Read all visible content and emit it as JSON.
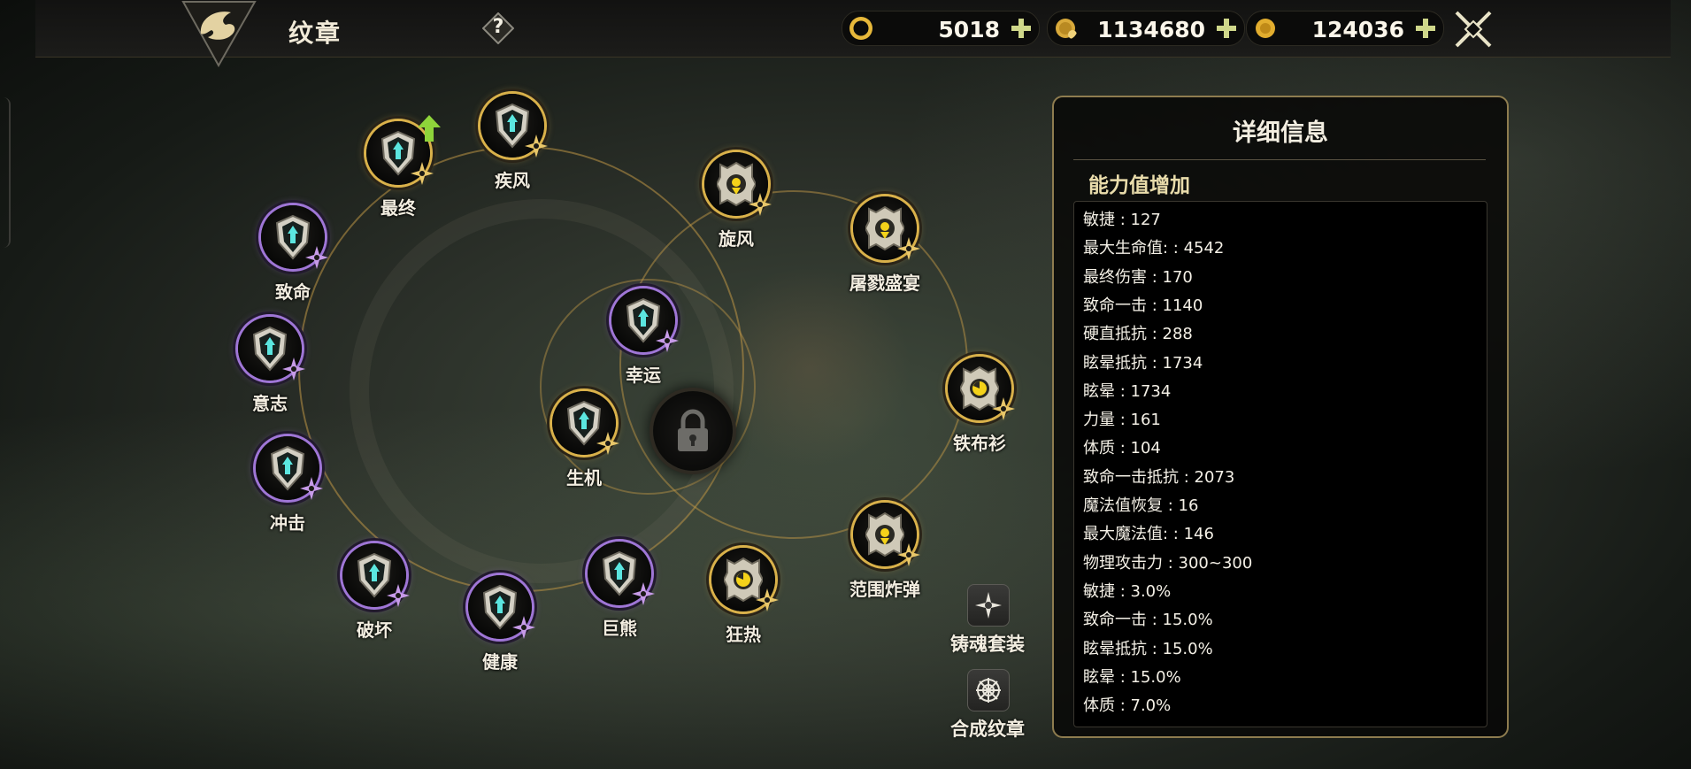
{
  "header": {
    "title": "纹章",
    "help_label": "?"
  },
  "currencies": [
    {
      "icon": "gear-coin-icon",
      "value": "5018",
      "color": "#e7b83a"
    },
    {
      "icon": "gold-coin-bag-icon",
      "value": "1134680",
      "color": "#d8a93a"
    },
    {
      "icon": "gold-coin-icon",
      "value": "124036",
      "color": "#e2ad2e"
    }
  ],
  "plus_label": "+",
  "emblems": [
    {
      "label": "最终",
      "icon": "shield-sword-icon",
      "glyph_color": "#5be6e0",
      "rank": "gold"
    },
    {
      "label": "疾风",
      "icon": "shield-wind-icon",
      "glyph_color": "#5be6e0",
      "rank": "gold"
    },
    {
      "label": "致命",
      "icon": "shield-fang-icon",
      "glyph_color": "#5be6e0",
      "rank": "purple"
    },
    {
      "label": "意志",
      "icon": "shield-cross-icon",
      "glyph_color": "#5be6e0",
      "rank": "purple"
    },
    {
      "label": "冲击",
      "icon": "shield-impact-icon",
      "glyph_color": "#5be6e0",
      "rank": "purple"
    },
    {
      "label": "破坏",
      "icon": "shield-break-icon",
      "glyph_color": "#5be6e0",
      "rank": "purple"
    },
    {
      "label": "健康",
      "icon": "shield-heart-icon",
      "glyph_color": "#5be6e0",
      "rank": "purple"
    },
    {
      "label": "巨熊",
      "icon": "shield-bear-icon",
      "glyph_color": "#5be6e0",
      "rank": "purple"
    },
    {
      "label": "幸运",
      "icon": "shield-clover-icon",
      "glyph_color": "#5be6e0",
      "rank": "purple"
    },
    {
      "label": "生机",
      "icon": "shield-life-icon",
      "glyph_color": "#5be6e0",
      "rank": "gold"
    },
    {
      "label": "旋风",
      "icon": "gear-emblem-icon",
      "glyph_color": "#f4d21a",
      "rank": "gold"
    },
    {
      "label": "屠戮盛宴",
      "icon": "gear-emblem-icon",
      "glyph_color": "#f4d21a",
      "rank": "gold"
    },
    {
      "label": "铁布衫",
      "icon": "gear-clock-icon",
      "glyph_color": "#f4d21a",
      "rank": "gold"
    },
    {
      "label": "范围炸弹",
      "icon": "gear-emblem-icon",
      "glyph_color": "#f4d21a",
      "rank": "gold"
    },
    {
      "label": "狂热",
      "icon": "gear-clock-icon",
      "glyph_color": "#f4d21a",
      "rank": "gold"
    }
  ],
  "actions": {
    "set_label": "铸魂套装",
    "combine_label": "合成纹章"
  },
  "details": {
    "title": "详细信息",
    "subtitle": "能力值增加",
    "stats": [
      "敏捷 : 127",
      "最大生命值:  : 4542",
      "最终伤害 : 170",
      "致命一击 : 1140",
      "硬直抵抗 : 288",
      "眩晕抵抗 : 1734",
      "眩晕 : 1734",
      "力量 : 161",
      "体质 : 104",
      "致命一击抵抗 : 2073",
      "魔法值恢复 : 16",
      "最大魔法值:  : 146",
      "物理攻击力 : 300~300",
      "敏捷 : 3.0%",
      "致命一击 : 15.0%",
      "眩晕抵抗 : 15.0%",
      "眩晕 : 15.0%",
      "体质 : 7.0%"
    ]
  },
  "colors": {
    "gold_ring": "#d9b14a",
    "purple_ring": "#9f76d6",
    "panel_border": "#8e7c4f",
    "cyan_glyph": "#5be6e0",
    "yellow_glyph": "#f4d21a"
  }
}
